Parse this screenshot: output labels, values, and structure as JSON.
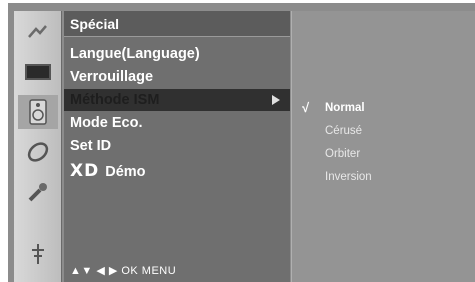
{
  "menu": {
    "title": "Spécial",
    "items": [
      {
        "label": "Langue(Language)"
      },
      {
        "label": "Verrouillage"
      },
      {
        "label": "Méthode ISM"
      },
      {
        "label": "Mode Eco."
      },
      {
        "label": "Set ID"
      },
      {
        "label": "Démo",
        "prefix": "XD"
      }
    ],
    "nav_hint": "▲▼  ◀ ▶  OK  MENU"
  },
  "submenu": {
    "check": "√",
    "items": [
      {
        "label": "Normal"
      },
      {
        "label": "Cérusé"
      },
      {
        "label": "Orbiter"
      },
      {
        "label": "Inversion"
      }
    ]
  },
  "icons": [
    "picture-icon",
    "screen-icon",
    "speaker-icon",
    "clock-icon",
    "wrench-icon",
    "input-icon"
  ]
}
